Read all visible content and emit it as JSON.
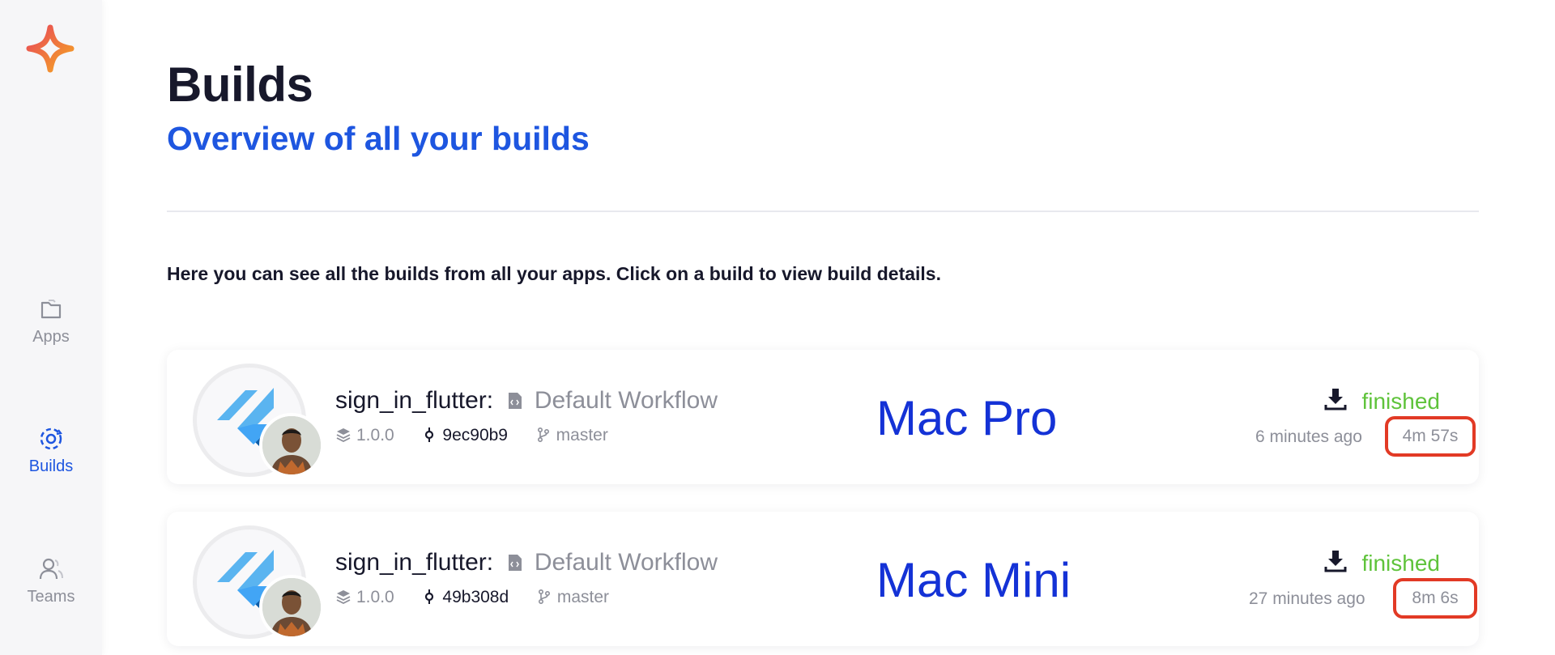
{
  "sidebar": {
    "items": [
      {
        "label": "Apps",
        "icon": "folder-icon",
        "active": false
      },
      {
        "label": "Builds",
        "icon": "builds-icon",
        "active": true
      },
      {
        "label": "Teams",
        "icon": "users-icon",
        "active": false
      }
    ]
  },
  "header": {
    "title": "Builds",
    "subtitle": "Overview of all your builds"
  },
  "intro_text": "Here you can see all the builds from all your apps. Click on a build to view build details.",
  "builds": [
    {
      "app_name": "sign_in_flutter:",
      "workflow": "Default Workflow",
      "version": "1.0.0",
      "commit": "9ec90b9",
      "branch": "master",
      "machine": "Mac Pro",
      "status": "finished",
      "time_ago": "6 minutes ago",
      "duration": "4m 57s"
    },
    {
      "app_name": "sign_in_flutter:",
      "workflow": "Default Workflow",
      "version": "1.0.0",
      "commit": "49b308d",
      "branch": "master",
      "machine": "Mac Mini",
      "status": "finished",
      "time_ago": "27 minutes ago",
      "duration": "8m 6s"
    }
  ],
  "colors": {
    "accent": "#1e56e0",
    "status_finished": "#5fc33b",
    "highlight_box": "#e23a25",
    "machine_label": "#1432d6"
  }
}
